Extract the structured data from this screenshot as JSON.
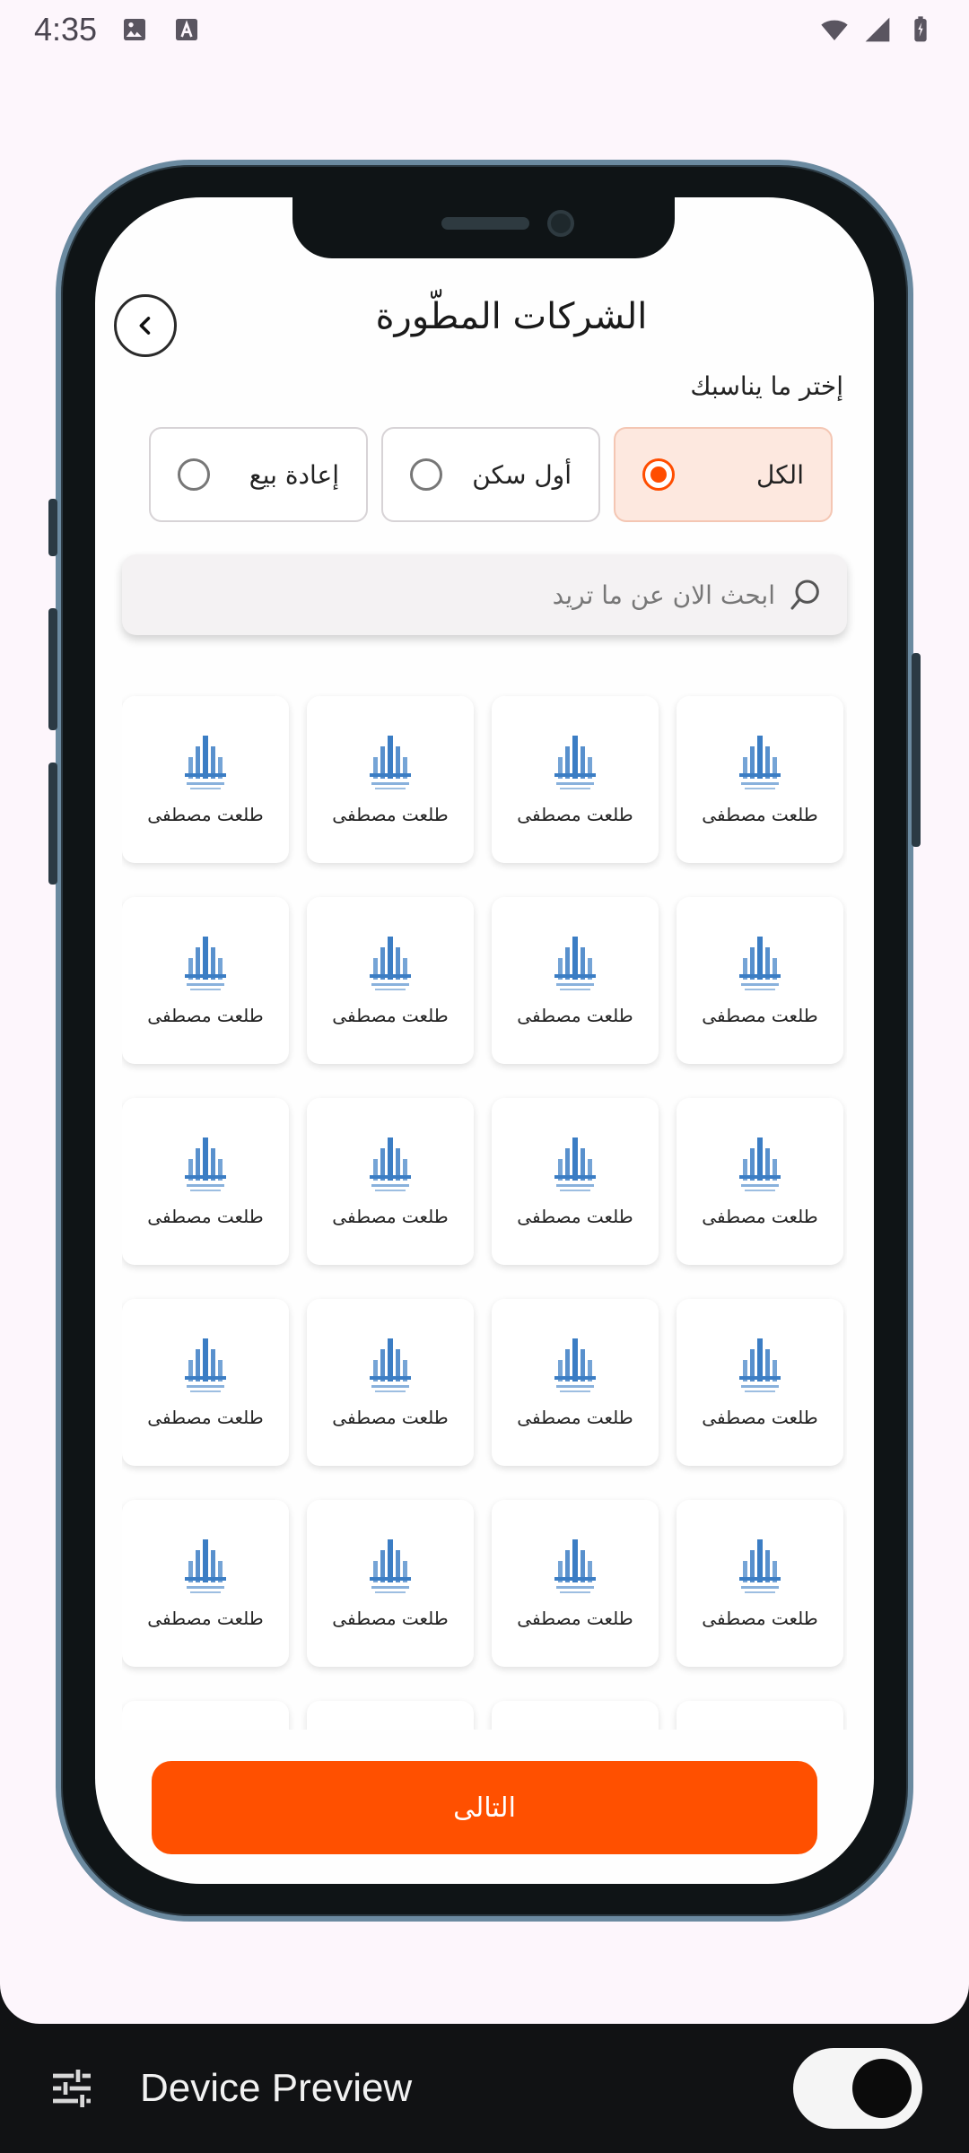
{
  "status_bar": {
    "time": "4:35",
    "icons": [
      "image-icon",
      "text-a-icon",
      "wifi-icon",
      "signal-icon",
      "battery-icon"
    ]
  },
  "app": {
    "title": "الشركات المطّورة",
    "subtitle": "إختر ما يناسبك",
    "filters": [
      {
        "label": "الكل",
        "selected": true
      },
      {
        "label": "أول سكن",
        "selected": false
      },
      {
        "label": "إعادة بيع",
        "selected": false
      }
    ],
    "search_placeholder": "ابحث الان عن ما تريد",
    "developer_label": "طلعت مصطفى",
    "grid_rows": 6,
    "grid_cols": 4,
    "next_label": "التالى"
  },
  "device_preview": {
    "title": "Device Preview",
    "toggle_on": true
  },
  "colors": {
    "accent": "#ff5000",
    "selected_bg": "#fde8df",
    "logo_blue": "#3b7dc4"
  }
}
